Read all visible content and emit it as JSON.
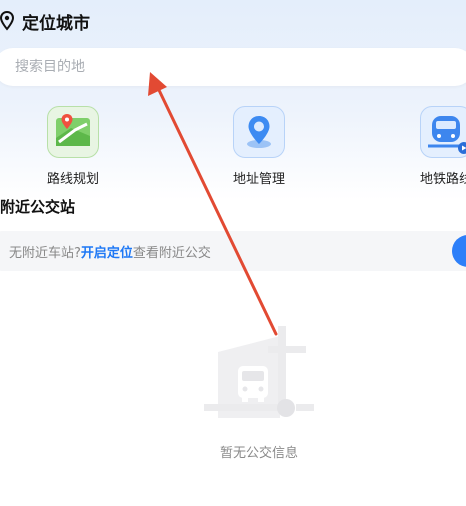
{
  "header": {
    "city_label": "定位城市"
  },
  "search": {
    "placeholder": "搜索目的地"
  },
  "shortcuts": [
    {
      "label": "路线规划",
      "icon": "route-map-icon"
    },
    {
      "label": "地址管理",
      "icon": "location-pin-icon"
    },
    {
      "label": "地铁路线",
      "icon": "subway-train-icon"
    }
  ],
  "nearby": {
    "title": "附近公交站",
    "prompt_prefix": "无附近车站?",
    "enable_link": "开启定位",
    "prompt_suffix": "查看附近公交"
  },
  "empty_state": {
    "text": "暂无公交信息",
    "icon": "bus-stop-icon"
  },
  "annotation": {
    "type": "red-arrow",
    "color": "#e24a33"
  },
  "colors": {
    "accent": "#1e78f5",
    "header_bg": "#e4eefb"
  }
}
